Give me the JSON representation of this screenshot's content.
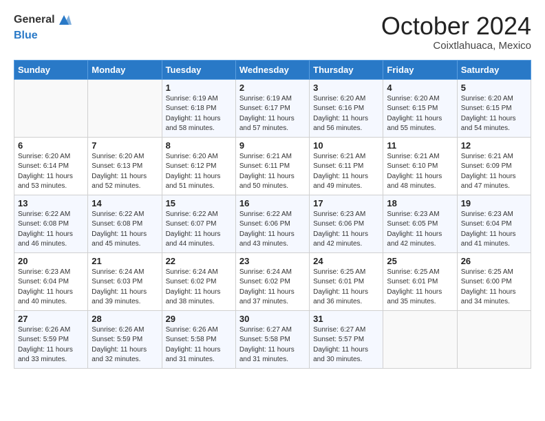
{
  "header": {
    "logo_general": "General",
    "logo_blue": "Blue",
    "month_title": "October 2024",
    "location": "Coixtlahuaca, Mexico"
  },
  "days_of_week": [
    "Sunday",
    "Monday",
    "Tuesday",
    "Wednesday",
    "Thursday",
    "Friday",
    "Saturday"
  ],
  "weeks": [
    [
      {
        "day": "",
        "sunrise": "",
        "sunset": "",
        "daylight": ""
      },
      {
        "day": "",
        "sunrise": "",
        "sunset": "",
        "daylight": ""
      },
      {
        "day": "1",
        "sunrise": "Sunrise: 6:19 AM",
        "sunset": "Sunset: 6:18 PM",
        "daylight": "Daylight: 11 hours and 58 minutes."
      },
      {
        "day": "2",
        "sunrise": "Sunrise: 6:19 AM",
        "sunset": "Sunset: 6:17 PM",
        "daylight": "Daylight: 11 hours and 57 minutes."
      },
      {
        "day": "3",
        "sunrise": "Sunrise: 6:20 AM",
        "sunset": "Sunset: 6:16 PM",
        "daylight": "Daylight: 11 hours and 56 minutes."
      },
      {
        "day": "4",
        "sunrise": "Sunrise: 6:20 AM",
        "sunset": "Sunset: 6:15 PM",
        "daylight": "Daylight: 11 hours and 55 minutes."
      },
      {
        "day": "5",
        "sunrise": "Sunrise: 6:20 AM",
        "sunset": "Sunset: 6:15 PM",
        "daylight": "Daylight: 11 hours and 54 minutes."
      }
    ],
    [
      {
        "day": "6",
        "sunrise": "Sunrise: 6:20 AM",
        "sunset": "Sunset: 6:14 PM",
        "daylight": "Daylight: 11 hours and 53 minutes."
      },
      {
        "day": "7",
        "sunrise": "Sunrise: 6:20 AM",
        "sunset": "Sunset: 6:13 PM",
        "daylight": "Daylight: 11 hours and 52 minutes."
      },
      {
        "day": "8",
        "sunrise": "Sunrise: 6:20 AM",
        "sunset": "Sunset: 6:12 PM",
        "daylight": "Daylight: 11 hours and 51 minutes."
      },
      {
        "day": "9",
        "sunrise": "Sunrise: 6:21 AM",
        "sunset": "Sunset: 6:11 PM",
        "daylight": "Daylight: 11 hours and 50 minutes."
      },
      {
        "day": "10",
        "sunrise": "Sunrise: 6:21 AM",
        "sunset": "Sunset: 6:11 PM",
        "daylight": "Daylight: 11 hours and 49 minutes."
      },
      {
        "day": "11",
        "sunrise": "Sunrise: 6:21 AM",
        "sunset": "Sunset: 6:10 PM",
        "daylight": "Daylight: 11 hours and 48 minutes."
      },
      {
        "day": "12",
        "sunrise": "Sunrise: 6:21 AM",
        "sunset": "Sunset: 6:09 PM",
        "daylight": "Daylight: 11 hours and 47 minutes."
      }
    ],
    [
      {
        "day": "13",
        "sunrise": "Sunrise: 6:22 AM",
        "sunset": "Sunset: 6:08 PM",
        "daylight": "Daylight: 11 hours and 46 minutes."
      },
      {
        "day": "14",
        "sunrise": "Sunrise: 6:22 AM",
        "sunset": "Sunset: 6:08 PM",
        "daylight": "Daylight: 11 hours and 45 minutes."
      },
      {
        "day": "15",
        "sunrise": "Sunrise: 6:22 AM",
        "sunset": "Sunset: 6:07 PM",
        "daylight": "Daylight: 11 hours and 44 minutes."
      },
      {
        "day": "16",
        "sunrise": "Sunrise: 6:22 AM",
        "sunset": "Sunset: 6:06 PM",
        "daylight": "Daylight: 11 hours and 43 minutes."
      },
      {
        "day": "17",
        "sunrise": "Sunrise: 6:23 AM",
        "sunset": "Sunset: 6:06 PM",
        "daylight": "Daylight: 11 hours and 42 minutes."
      },
      {
        "day": "18",
        "sunrise": "Sunrise: 6:23 AM",
        "sunset": "Sunset: 6:05 PM",
        "daylight": "Daylight: 11 hours and 42 minutes."
      },
      {
        "day": "19",
        "sunrise": "Sunrise: 6:23 AM",
        "sunset": "Sunset: 6:04 PM",
        "daylight": "Daylight: 11 hours and 41 minutes."
      }
    ],
    [
      {
        "day": "20",
        "sunrise": "Sunrise: 6:23 AM",
        "sunset": "Sunset: 6:04 PM",
        "daylight": "Daylight: 11 hours and 40 minutes."
      },
      {
        "day": "21",
        "sunrise": "Sunrise: 6:24 AM",
        "sunset": "Sunset: 6:03 PM",
        "daylight": "Daylight: 11 hours and 39 minutes."
      },
      {
        "day": "22",
        "sunrise": "Sunrise: 6:24 AM",
        "sunset": "Sunset: 6:02 PM",
        "daylight": "Daylight: 11 hours and 38 minutes."
      },
      {
        "day": "23",
        "sunrise": "Sunrise: 6:24 AM",
        "sunset": "Sunset: 6:02 PM",
        "daylight": "Daylight: 11 hours and 37 minutes."
      },
      {
        "day": "24",
        "sunrise": "Sunrise: 6:25 AM",
        "sunset": "Sunset: 6:01 PM",
        "daylight": "Daylight: 11 hours and 36 minutes."
      },
      {
        "day": "25",
        "sunrise": "Sunrise: 6:25 AM",
        "sunset": "Sunset: 6:01 PM",
        "daylight": "Daylight: 11 hours and 35 minutes."
      },
      {
        "day": "26",
        "sunrise": "Sunrise: 6:25 AM",
        "sunset": "Sunset: 6:00 PM",
        "daylight": "Daylight: 11 hours and 34 minutes."
      }
    ],
    [
      {
        "day": "27",
        "sunrise": "Sunrise: 6:26 AM",
        "sunset": "Sunset: 5:59 PM",
        "daylight": "Daylight: 11 hours and 33 minutes."
      },
      {
        "day": "28",
        "sunrise": "Sunrise: 6:26 AM",
        "sunset": "Sunset: 5:59 PM",
        "daylight": "Daylight: 11 hours and 32 minutes."
      },
      {
        "day": "29",
        "sunrise": "Sunrise: 6:26 AM",
        "sunset": "Sunset: 5:58 PM",
        "daylight": "Daylight: 11 hours and 31 minutes."
      },
      {
        "day": "30",
        "sunrise": "Sunrise: 6:27 AM",
        "sunset": "Sunset: 5:58 PM",
        "daylight": "Daylight: 11 hours and 31 minutes."
      },
      {
        "day": "31",
        "sunrise": "Sunrise: 6:27 AM",
        "sunset": "Sunset: 5:57 PM",
        "daylight": "Daylight: 11 hours and 30 minutes."
      },
      {
        "day": "",
        "sunrise": "",
        "sunset": "",
        "daylight": ""
      },
      {
        "day": "",
        "sunrise": "",
        "sunset": "",
        "daylight": ""
      }
    ]
  ]
}
